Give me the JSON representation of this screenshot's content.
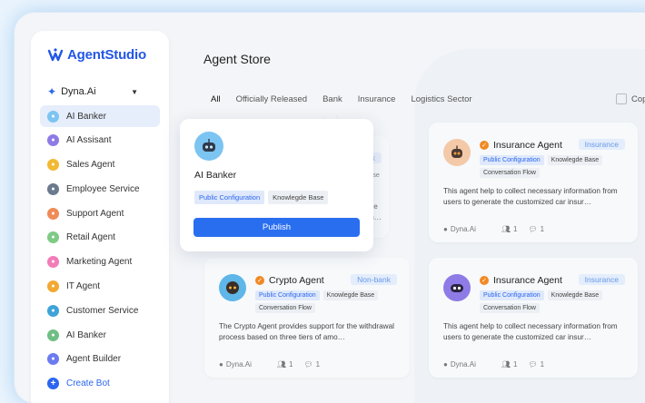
{
  "brand": {
    "name": "AgentStudio",
    "color": "#2356e6"
  },
  "workspace": {
    "name": "Dyna.Ai",
    "icon": "sparkle-icon"
  },
  "nav": [
    {
      "label": "AI Banker",
      "active": true,
      "color": "#7cc4f2",
      "glyph": "●"
    },
    {
      "label": "AI Assisant",
      "color": "#8f7be6",
      "glyph": "●"
    },
    {
      "label": "Sales Agent",
      "color": "#f2b933",
      "glyph": "●"
    },
    {
      "label": "Employee Service",
      "color": "#6b7a8f",
      "glyph": "●"
    },
    {
      "label": "Support Agent",
      "color": "#f08a58",
      "glyph": "●"
    },
    {
      "label": "Retail Agent",
      "color": "#7ecb86",
      "glyph": "●"
    },
    {
      "label": "Marketing Agent",
      "color": "#f27bb8",
      "glyph": "●"
    },
    {
      "label": "IT Agent",
      "color": "#f2a833",
      "glyph": "●"
    },
    {
      "label": "Customer Service",
      "color": "#3ea3d8",
      "glyph": "●"
    },
    {
      "label": "AI Banker",
      "color": "#6fbf84",
      "glyph": "●"
    },
    {
      "label": "Agent Builder",
      "color": "#6b7cf0",
      "glyph": "●"
    }
  ],
  "create_bot": {
    "label": "Create Bot",
    "glyph": "+"
  },
  "main": {
    "title": "Agent Store",
    "filters": [
      "All",
      "Officially Released",
      "Bank",
      "Insurance",
      "Logistics Sector"
    ],
    "copy_label": "Cop"
  },
  "popup": {
    "name": "AI Banker",
    "tags": [
      "Public Configuration",
      "Knowlegde Base"
    ],
    "publish_label": "Publish"
  },
  "cards": [
    {
      "name": "Insurance Agent",
      "category": "Insurance",
      "tags": [
        "Public Configuration",
        "Knowlegde Base",
        "Conversation Flow"
      ],
      "desc": "This agent help to collect necessary information from users to generate the customized car insur…",
      "owner": "Dyna.Ai",
      "users": "1",
      "convs": "1",
      "icon_color": "#f4c9a8"
    },
    {
      "name": "Crypto Agent",
      "category": "Non-bank",
      "tags": [
        "Public Configuration",
        "Knowlegde Base",
        "Conversation Flow"
      ],
      "desc": "The Crypto Agent provides support for the withdrawal process based on three tiers of amo…",
      "owner": "Dyna.Ai",
      "users": "1",
      "convs": "1",
      "icon_color": "#5fb6e8"
    },
    {
      "name": "Insurance Agent",
      "category": "Insurance",
      "tags": [
        "Public Configuration",
        "Knowlegde Base",
        "Conversation Flow"
      ],
      "desc": "This agent help to collect necessary information from users to generate the customized car insur…",
      "owner": "Dyna.Ai",
      "users": "1",
      "convs": "1",
      "icon_color": "#8f7be6"
    },
    {
      "name": "Bank",
      "category": "Bank",
      "tags": [
        "Public Configuration",
        "Knowlegde Base"
      ],
      "desc": "ervice ation…",
      "owner": "",
      "users": "",
      "convs": ""
    }
  ]
}
